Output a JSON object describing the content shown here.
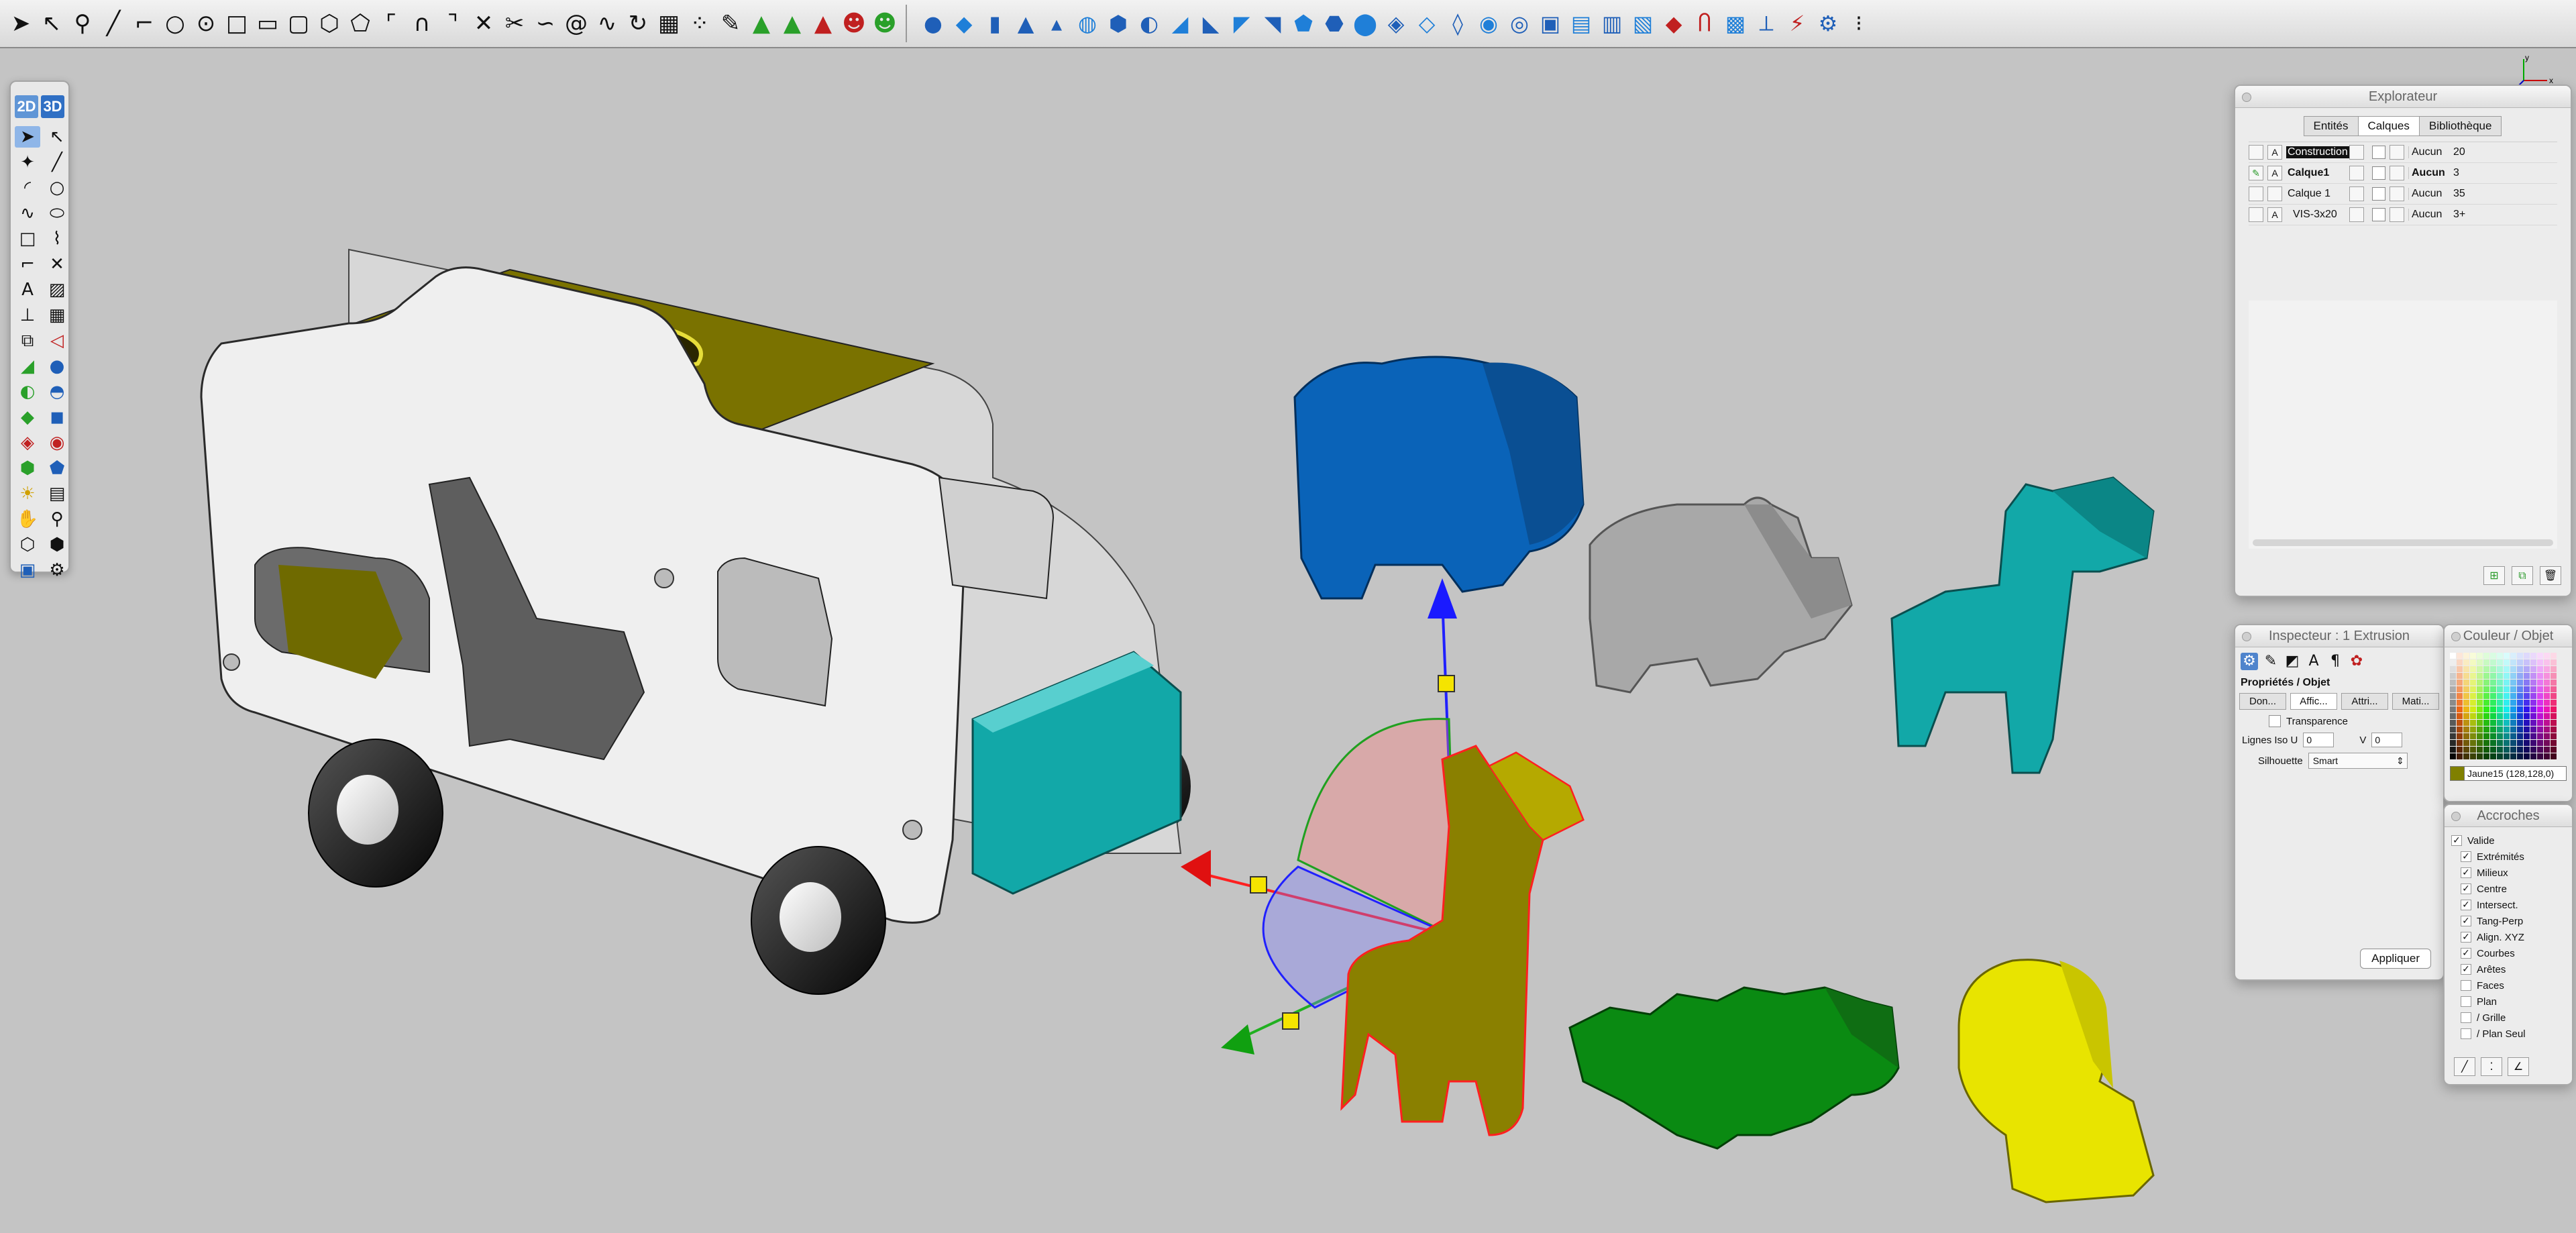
{
  "colors": {
    "blue_part": "#0a63b8",
    "grey_part": "#a8a8a8",
    "teal_part": "#12a8a8",
    "olive_part": "#8a8000",
    "green_part": "#0a8a12",
    "yellow_part": "#e8e400",
    "truck_body": "#efefef",
    "truck_accent": "#12a8a8",
    "roof": "#7a7200"
  },
  "palette": {
    "mode_2d": "2D",
    "mode_3d": "3D"
  },
  "explorer": {
    "title": "Explorateur",
    "tabs": [
      {
        "label": "Entités"
      },
      {
        "label": "Calques"
      },
      {
        "label": "Bibliothèque"
      }
    ],
    "layers": [
      {
        "name": "Construction",
        "style": "Aucun",
        "width": "20",
        "color": "#ffffff"
      },
      {
        "name": "Calque1",
        "style": "Aucun",
        "width": "3",
        "color": "#ffffff"
      },
      {
        "name": "Calque 1",
        "style": "Aucun",
        "width": "35",
        "color": "#ffffff"
      },
      {
        "name": "VIS-3x20",
        "style": "Aucun",
        "width": "3+",
        "color": "#ffffff"
      }
    ]
  },
  "inspector": {
    "title": "Inspecteur : 1 Extrusion",
    "heading": "Propriétés / Objet",
    "tabs": [
      {
        "label": "Don..."
      },
      {
        "label": "Affic..."
      },
      {
        "label": "Attri..."
      },
      {
        "label": "Mati..."
      }
    ],
    "transparency_label": "Transparence",
    "iso_label": "Lignes Iso U",
    "iso_u": "0",
    "v_label": "V",
    "iso_v": "0",
    "silhouette_label": "Silhouette",
    "silhouette_value": "Smart",
    "apply_label": "Appliquer"
  },
  "color_panel": {
    "title": "Couleur / Objet",
    "current_name": "Jaune15 (128,128,0)",
    "current_color": "#808000"
  },
  "snaps": {
    "title": "Accroches",
    "items": [
      {
        "label": "Valide",
        "checked": true,
        "indent": false
      },
      {
        "label": "Extrémités",
        "checked": true,
        "indent": true
      },
      {
        "label": "Milieux",
        "checked": true,
        "indent": true
      },
      {
        "label": "Centre",
        "checked": true,
        "indent": true
      },
      {
        "label": "Intersect.",
        "checked": true,
        "indent": true
      },
      {
        "label": "Tang-Perp",
        "checked": true,
        "indent": true
      },
      {
        "label": "Align. XYZ",
        "checked": true,
        "indent": true
      },
      {
        "label": "Courbes",
        "checked": true,
        "indent": true
      },
      {
        "label": "Arêtes",
        "checked": true,
        "indent": true
      },
      {
        "label": "Faces",
        "checked": false,
        "indent": true
      },
      {
        "label": "Plan",
        "checked": false,
        "indent": true
      },
      {
        "label": "/ Grille",
        "checked": false,
        "indent": true
      },
      {
        "label": "/ Plan Seul",
        "checked": false,
        "indent": true
      }
    ]
  },
  "axes": {
    "x": "x",
    "y": "y",
    "z": "z"
  }
}
